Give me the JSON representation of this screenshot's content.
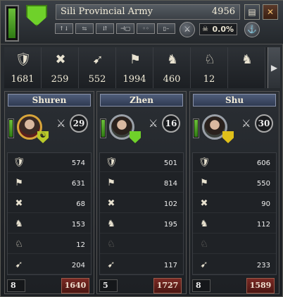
{
  "header": {
    "army_name": "Sili Provincial Army",
    "army_men": "4956",
    "casualty_pct": "0.0%",
    "buttons": {
      "ledger": "▤",
      "close": "✕",
      "circle": "⚓"
    },
    "tools": [
      "↑↓",
      "⇆",
      "⇵",
      "⊣▢",
      "◦◦",
      "▯–"
    ],
    "org_level": 0.92
  },
  "summary": [
    {
      "icon": "archer-icon",
      "glyph": "🛡",
      "value": "1681"
    },
    {
      "icon": "pikemen-icon",
      "glyph": "✖",
      "value": "259"
    },
    {
      "icon": "crossbow-icon",
      "glyph": "➹",
      "value": "552"
    },
    {
      "icon": "infantry-icon",
      "glyph": "⚑",
      "value": "1994"
    },
    {
      "icon": "cavalry-icon",
      "glyph": "♞",
      "value": "460"
    },
    {
      "icon": "heavy-cavalry-icon",
      "glyph": "♘",
      "value": "12"
    },
    {
      "icon": "empty-cavalry-icon",
      "glyph": "♞",
      "value": ""
    }
  ],
  "columns": [
    {
      "name": "Shuren",
      "skill": "29",
      "shield_color": "#b9c92a",
      "shield_glyph": "☯",
      "portrait": "color",
      "units": [
        {
          "icon": "archer-icon",
          "glyph": "🛡",
          "value": "574"
        },
        {
          "icon": "infantry-icon",
          "glyph": "⚑",
          "value": "631"
        },
        {
          "icon": "pikemen-icon",
          "glyph": "✖",
          "value": "68"
        },
        {
          "icon": "cavalry-icon",
          "glyph": "♞",
          "value": "153"
        },
        {
          "icon": "heavy-cavalry-icon",
          "glyph": "♘",
          "value": "12"
        },
        {
          "icon": "crossbow-icon",
          "glyph": "➹",
          "value": "204"
        }
      ],
      "footer_left": "8",
      "footer_right": "1640"
    },
    {
      "name": "Zhen",
      "skill": "16",
      "shield_color": "#6fd12a",
      "shield_glyph": "",
      "portrait": "gray",
      "units": [
        {
          "icon": "archer-icon",
          "glyph": "🛡",
          "value": "501"
        },
        {
          "icon": "infantry-icon",
          "glyph": "⚑",
          "value": "814"
        },
        {
          "icon": "pikemen-icon",
          "glyph": "✖",
          "value": "102"
        },
        {
          "icon": "cavalry-icon",
          "glyph": "♞",
          "value": "195"
        },
        {
          "icon": "heavy-cavalry-icon",
          "glyph": "♘",
          "value": ""
        },
        {
          "icon": "crossbow-icon",
          "glyph": "➹",
          "value": "117"
        }
      ],
      "footer_left": "5",
      "footer_right": "1727"
    },
    {
      "name": "Shu",
      "skill": "30",
      "shield_color": "#e0c01a",
      "shield_glyph": "",
      "portrait": "gray",
      "units": [
        {
          "icon": "archer-icon",
          "glyph": "🛡",
          "value": "606"
        },
        {
          "icon": "infantry-icon",
          "glyph": "⚑",
          "value": "550"
        },
        {
          "icon": "pikemen-icon",
          "glyph": "✖",
          "value": "90"
        },
        {
          "icon": "cavalry-icon",
          "glyph": "♞",
          "value": "112"
        },
        {
          "icon": "heavy-cavalry-icon",
          "glyph": "♘",
          "value": ""
        },
        {
          "icon": "crossbow-icon",
          "glyph": "➹",
          "value": "233"
        }
      ],
      "footer_left": "8",
      "footer_right": "1589"
    }
  ]
}
